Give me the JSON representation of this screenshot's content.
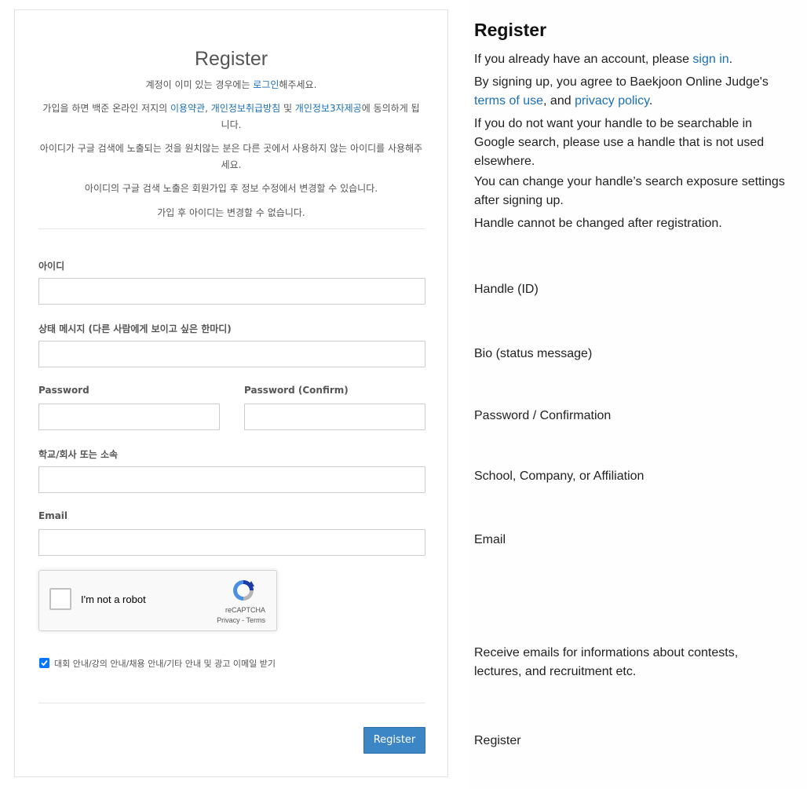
{
  "form": {
    "title": "Register",
    "notice": {
      "login_prefix": "계정이 이미 있는 경우에는 ",
      "login_link": "로그인",
      "login_suffix": "해주세요.",
      "agree_prefix": "가입을 하면 백준 온라인 저지의 ",
      "terms_link": "이용약관",
      "comma": ", ",
      "privacy_link": "개인정보취급방침",
      "and": " 및 ",
      "thirdparty_link": "개인정보3자제공",
      "agree_suffix": "에 동의하게 됩니다.",
      "search_notice": "아이디가 구글 검색에 노출되는 것을 원치않는 분은 다른 곳에서 사용하지 않는 아이디를 사용해주세요.",
      "exposure_notice": "아이디의 구글 검색 노출은 회원가입 후 정보 수정에서 변경할 수 있습니다.",
      "handle_notice": "가입 후 아이디는 변경할 수 없습니다."
    },
    "fields": {
      "handle_label": "아이디",
      "bio_label": "상태 메시지 (다른 사람에게 보이고 싶은 한마디)",
      "password_label": "Password",
      "password_confirm_label": "Password (Confirm)",
      "school_label": "학교/회사 또는 소속",
      "email_label": "Email"
    },
    "captcha": {
      "label": "I'm not a robot",
      "brand": "reCAPTCHA",
      "privacy": "Privacy",
      "sep": " - ",
      "terms": "Terms"
    },
    "email_optin": {
      "checked": true,
      "label": "대회 안내/강의 안내/채용 안내/기타 안내 및 광고 이메일 받기"
    },
    "submit_label": "Register"
  },
  "translation": {
    "title": "Register",
    "signin_prefix": "If you already have an account, please ",
    "signin_link": "sign in",
    "signin_suffix": ".",
    "agree_prefix": "By signing up, you agree to Baekjoon Online Judge's ",
    "terms_link": "terms of use",
    "agree_mid": ", and ",
    "privacy_link": "privacy policy",
    "agree_suffix": ".",
    "search_notice": "If you do not want your handle to be searchable in Google search, please use a handle that is not used elsewhere.",
    "exposure_notice": "You can change your handle’s search exposure settings after signing up.",
    "handle_notice": "Handle cannot be changed after registration.",
    "handle_label": "Handle (ID)",
    "bio_label": "Bio (status message)",
    "password_label": "Password / Confirmation",
    "school_label": "School, Company, or Affiliation",
    "email_label": "Email",
    "optin_label": "Receive emails for informations about contests, lectures, and recruitment etc.",
    "register_label": "Register"
  },
  "colors": {
    "link": "#1a6fb5",
    "button": "#3c86c6",
    "checkbox": "#0075ff"
  }
}
